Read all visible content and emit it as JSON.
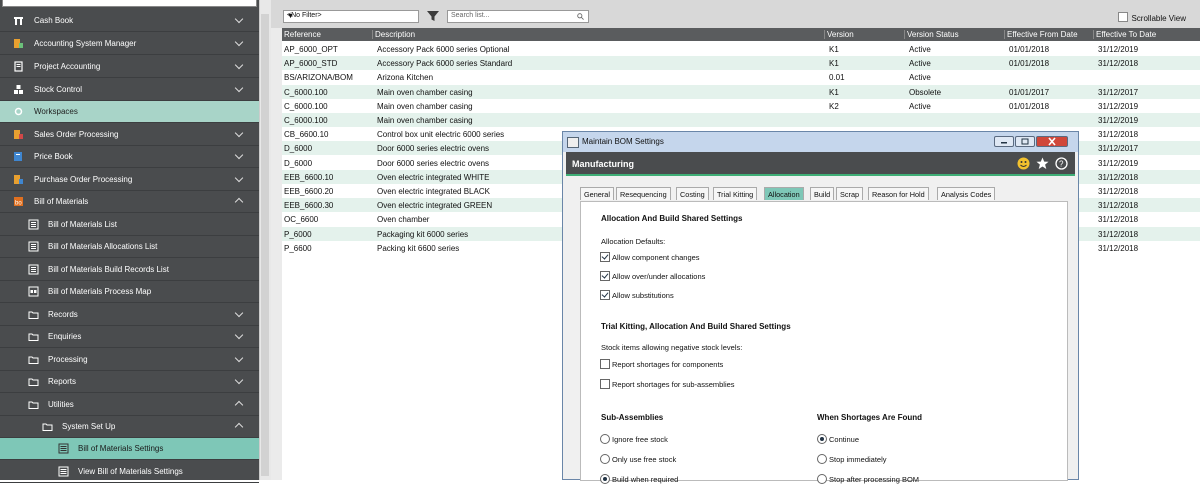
{
  "sidebar": {
    "items": [
      {
        "label": "Cash Book",
        "icon": "cash-book-icon",
        "chevron": "down"
      },
      {
        "label": "Accounting System Manager",
        "icon": "accounting-manager-icon",
        "chevron": "down"
      },
      {
        "label": "Project Accounting",
        "icon": "project-accounting-icon",
        "chevron": "down"
      },
      {
        "label": "Stock Control",
        "icon": "stock-control-icon",
        "chevron": "down"
      },
      {
        "label": "Workspaces",
        "icon": "workspaces-icon",
        "chevron": "none"
      },
      {
        "label": "Sales Order Processing",
        "icon": "sales-order-icon",
        "chevron": "down"
      },
      {
        "label": "Price Book",
        "icon": "price-book-icon",
        "chevron": "down"
      },
      {
        "label": "Purchase Order Processing",
        "icon": "purchase-order-icon",
        "chevron": "down"
      },
      {
        "label": "Bill of Materials",
        "icon": "bill-of-materials-icon",
        "chevron": "up"
      },
      {
        "label": "Bill of Materials List",
        "icon": "list-icon",
        "chevron": "none"
      },
      {
        "label": "Bill of Materials Allocations List",
        "icon": "list-icon",
        "chevron": "none"
      },
      {
        "label": "Bill of Materials Build Records List",
        "icon": "list-icon",
        "chevron": "none"
      },
      {
        "label": "Bill of Materials Process Map",
        "icon": "process-map-icon",
        "chevron": "none"
      },
      {
        "label": "Records",
        "icon": "folder-icon",
        "chevron": "down"
      },
      {
        "label": "Enquiries",
        "icon": "folder-icon",
        "chevron": "down"
      },
      {
        "label": "Processing",
        "icon": "folder-icon",
        "chevron": "down"
      },
      {
        "label": "Reports",
        "icon": "folder-icon",
        "chevron": "down"
      },
      {
        "label": "Utilities",
        "icon": "folder-icon",
        "chevron": "up"
      },
      {
        "label": "System Set Up",
        "icon": "folder-icon",
        "chevron": "up"
      },
      {
        "label": "Bill of Materials Settings",
        "icon": "settings-form-icon",
        "chevron": "none"
      },
      {
        "label": "View Bill of Materials Settings",
        "icon": "settings-form-icon",
        "chevron": "none"
      }
    ]
  },
  "toolbar": {
    "filter_value": "<No Filter>",
    "search_placeholder": "Search list...",
    "scrollable_label": "Scrollable View"
  },
  "grid": {
    "headers": [
      "Reference",
      "Description",
      "Version",
      "Version Status",
      "Effective From Date",
      "Effective To Date"
    ],
    "rows": [
      [
        "AP_6000_OPT",
        "Accessory Pack 6000 series Optional",
        "K1",
        "Active",
        "01/01/2018",
        "31/12/2019"
      ],
      [
        "AP_6000_STD",
        "Accessory Pack 6000 series Standard",
        "K1",
        "Active",
        "01/01/2018",
        "31/12/2018"
      ],
      [
        "BS/ARIZONA/BOM",
        "Arizona Kitchen",
        "0.01",
        "Active",
        "",
        ""
      ],
      [
        "C_6000.100",
        "Main oven chamber casing",
        "K1",
        "Obsolete",
        "01/01/2017",
        "31/12/2017"
      ],
      [
        "C_6000.100",
        "Main oven chamber casing",
        "K2",
        "Active",
        "01/01/2018",
        "31/12/2019"
      ],
      [
        "C_6000.100",
        "Main oven chamber casing",
        "",
        "",
        "",
        "31/12/2019"
      ],
      [
        "CB_6600.10",
        "Control box unit electric 6000 series",
        "",
        "",
        "",
        "31/12/2018"
      ],
      [
        "D_6000",
        "Door 6000 series electric ovens",
        "",
        "",
        "",
        "31/12/2017"
      ],
      [
        "D_6000",
        "Door 6000 series electric ovens",
        "",
        "",
        "",
        "31/12/2019"
      ],
      [
        "EEB_6600.10",
        "Oven electric integrated WHITE",
        "",
        "",
        "",
        "31/12/2018"
      ],
      [
        "EEB_6600.20",
        "Oven electric integrated BLACK",
        "",
        "",
        "",
        "31/12/2018"
      ],
      [
        "EEB_6600.30",
        "Oven electric integrated GREEN",
        "",
        "",
        "",
        "31/12/2018"
      ],
      [
        "OC_6600",
        "Oven chamber",
        "",
        "",
        "",
        "31/12/2018"
      ],
      [
        "P_6000",
        "Packaging kit 6000 series",
        "",
        "",
        "",
        "31/12/2018"
      ],
      [
        "P_6600",
        "Packing kit 6600 series",
        "",
        "",
        "",
        "31/12/2018"
      ]
    ]
  },
  "dialog": {
    "title": "Maintain BOM Settings",
    "section_header": "Manufacturing",
    "tabs": [
      "General",
      "Resequencing",
      "Costing",
      "Trial Kitting",
      "Allocation",
      "Build",
      "Scrap",
      "Reason for Hold",
      "Analysis Codes"
    ],
    "selected_tab": "Allocation",
    "allocation_title": "Allocation And Build Shared Settings",
    "allocation_defaults_label": "Allocation Defaults:",
    "allocation_checks": [
      {
        "label": "Allow component changes",
        "checked": true
      },
      {
        "label": "Allow over/under allocations",
        "checked": true
      },
      {
        "label": "Allow substitutions",
        "checked": true
      }
    ],
    "trial_title": "Trial Kitting, Allocation And Build Shared Settings",
    "negative_stock_label": "Stock items allowing negative stock levels:",
    "trial_checks": [
      {
        "label": "Report shortages for components",
        "checked": false
      },
      {
        "label": "Report shortages for sub-assemblies",
        "checked": false
      }
    ],
    "subassemblies_title": "Sub-Assemblies",
    "subassemblies_options": [
      {
        "label": "Ignore free stock",
        "selected": false
      },
      {
        "label": "Only use free stock",
        "selected": false
      },
      {
        "label": "Build when required",
        "selected": true
      }
    ],
    "shortages_title": "When Shortages Are Found",
    "shortages_options": [
      {
        "label": "Continue",
        "selected": true
      },
      {
        "label": "Stop immediately",
        "selected": false
      },
      {
        "label": "Stop after processing BOM",
        "selected": false
      }
    ]
  },
  "colors": {
    "sidebar_bg": "#4a4c4e",
    "accent": "#7ec7b7",
    "alt_row": "#e4f2ec",
    "header_bg": "#5a5c5e"
  }
}
